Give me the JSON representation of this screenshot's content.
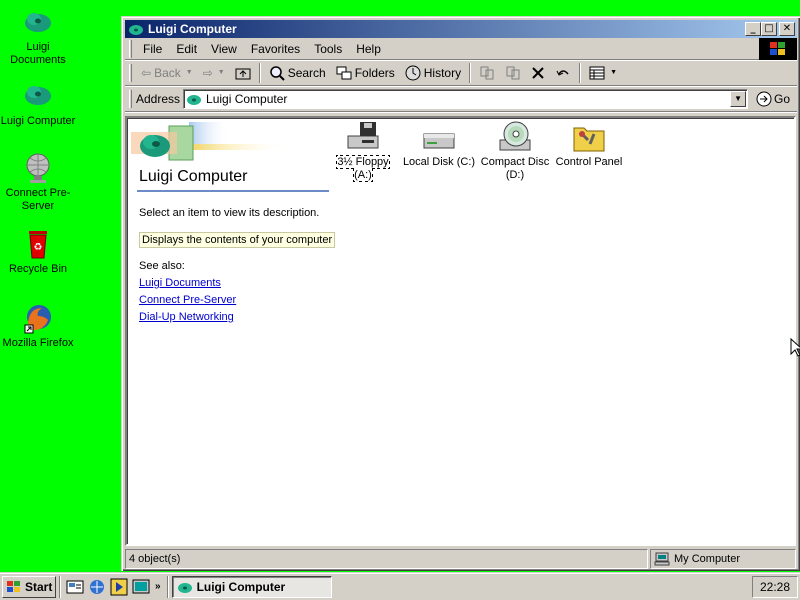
{
  "desktop": {
    "icons": [
      {
        "label": "Luigi Documents",
        "icon": "cloud-folder-icon"
      },
      {
        "label": "Luigi Computer",
        "icon": "cloud-computer-icon"
      },
      {
        "label": "Connect Pre-Server",
        "icon": "network-globe-icon"
      },
      {
        "label": "Recycle Bin",
        "icon": "recycle-bin-icon"
      },
      {
        "label": "Mozilla Firefox",
        "icon": "firefox-icon"
      }
    ]
  },
  "window": {
    "title": "Luigi Computer",
    "buttons": {
      "minimize": "_",
      "maximize": "□",
      "close": "✕"
    },
    "menu": [
      "File",
      "Edit",
      "View",
      "Favorites",
      "Tools",
      "Help"
    ],
    "toolbar": {
      "back": "Back",
      "forward": "⇨",
      "search": "Search",
      "folders": "Folders",
      "history": "History"
    },
    "address": {
      "label": "Address",
      "value": "Luigi Computer",
      "go": "Go"
    },
    "panel": {
      "title": "Luigi Computer",
      "description": "Select an item to view its description.",
      "info": "Displays the contents of your computer",
      "see_also": "See also:",
      "links": [
        "Luigi Documents",
        "Connect Pre-Server",
        "Dial-Up Networking"
      ]
    },
    "drives": [
      {
        "label": "3½ Floppy (A:)",
        "icon": "floppy-drive-icon",
        "selected": true
      },
      {
        "label": "Local Disk (C:)",
        "icon": "hard-disk-icon",
        "selected": false
      },
      {
        "label": "Compact Disc (D:)",
        "icon": "cd-drive-icon",
        "selected": false
      },
      {
        "label": "Control Panel",
        "icon": "control-panel-icon",
        "selected": false
      }
    ],
    "status": {
      "objects": "4 object(s)",
      "location": "My Computer"
    }
  },
  "taskbar": {
    "start": "Start",
    "chevron": "»",
    "task": "Luigi Computer",
    "clock": "22:28"
  },
  "colors": {
    "desktop": "#00ff00",
    "titlebar_start": "#0a246a",
    "titlebar_end": "#a6caf0",
    "link": "#0000cc",
    "face": "#d4d0c8"
  }
}
